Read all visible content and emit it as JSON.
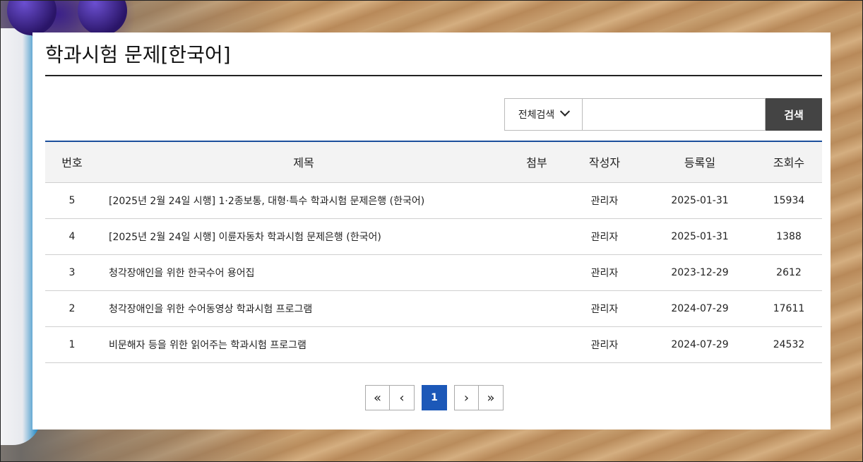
{
  "page_title": "학과시험 문제[한국어]",
  "search": {
    "scope_selected": "전체검색",
    "input_value": "",
    "button_label": "검색"
  },
  "table": {
    "headers": {
      "no": "번호",
      "title": "제목",
      "attachment": "첨부",
      "author": "작성자",
      "date": "등록일",
      "views": "조회수"
    },
    "rows": [
      {
        "no": "5",
        "title": "[2025년 2월 24일 시행] 1·2종보통, 대형·특수 학과시험 문제은행 (한국어)",
        "attachment": "",
        "author": "관리자",
        "date": "2025-01-31",
        "views": "15934"
      },
      {
        "no": "4",
        "title": "[2025년 2월 24일 시행] 이륜자동차 학과시험 문제은행 (한국어)",
        "attachment": "",
        "author": "관리자",
        "date": "2025-01-31",
        "views": "1388"
      },
      {
        "no": "3",
        "title": "청각장애인을 위한 한국수어 용어집",
        "attachment": "",
        "author": "관리자",
        "date": "2023-12-29",
        "views": "2612"
      },
      {
        "no": "2",
        "title": "청각장애인을 위한 수어동영상 학과시험 프로그램",
        "attachment": "",
        "author": "관리자",
        "date": "2024-07-29",
        "views": "17611"
      },
      {
        "no": "1",
        "title": "비문해자 등을 위한 읽어주는 학과시험 프로그램",
        "attachment": "",
        "author": "관리자",
        "date": "2024-07-29",
        "views": "24532"
      }
    ]
  },
  "pagination": {
    "first": "«",
    "prev": "‹",
    "current": "1",
    "next": "›",
    "last": "»"
  },
  "colors": {
    "accent_blue": "#1c58b8",
    "table_top_rule": "#1c4f9c",
    "search_button": "#444444"
  }
}
